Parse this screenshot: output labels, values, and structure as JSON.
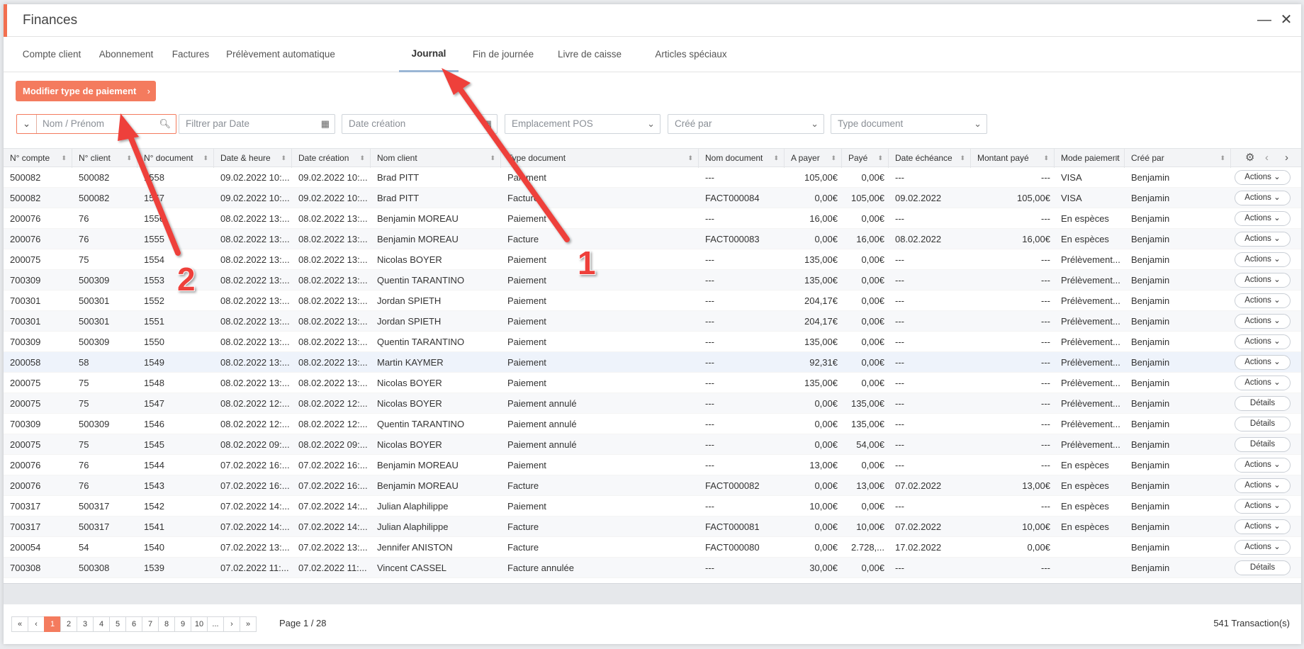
{
  "window": {
    "title": "Finances",
    "minimize_symbol": "—",
    "close_symbol": "✕"
  },
  "tabs": [
    {
      "label": "Compte client",
      "active": false
    },
    {
      "label": "Abonnement",
      "active": false
    },
    {
      "label": "Factures",
      "active": false
    },
    {
      "label": "Prélèvement automatique",
      "active": false
    },
    {
      "label": "Journal",
      "active": true
    },
    {
      "label": "Fin de journée",
      "active": false
    },
    {
      "label": "Livre de caisse",
      "active": false
    },
    {
      "label": "Articles spéciaux",
      "active": false
    }
  ],
  "toolbar": {
    "modify_payment_label": "Modifier type de paiement"
  },
  "filters": {
    "search_placeholder": "Nom / Prénom",
    "date_placeholder": "Filtrer par Date",
    "creation_date_placeholder": "Date création",
    "pos_placeholder": "Emplacement POS",
    "created_by_placeholder": "Créé par",
    "doc_type_placeholder": "Type document"
  },
  "columns": [
    "N° compte",
    "N° client",
    "N° document",
    "Date & heure",
    "Date création",
    "Nom client",
    "Type document",
    "Nom document",
    "A payer",
    "Payé",
    "Date échéance",
    "Montant payé",
    "Mode paiement",
    "Créé par"
  ],
  "rows": [
    {
      "cells": [
        "500082",
        "500082",
        "1558",
        "09.02.2022 10:...",
        "09.02.2022 10:...",
        "Brad PITT",
        "Paiement",
        "---",
        "105,00€",
        "0,00€",
        "---",
        "---",
        "VISA",
        "Benjamin"
      ],
      "action": "Actions ⌄"
    },
    {
      "cells": [
        "500082",
        "500082",
        "1557",
        "09.02.2022 10:...",
        "09.02.2022 10:...",
        "Brad PITT",
        "Facture",
        "FACT000084",
        "0,00€",
        "105,00€",
        "09.02.2022",
        "105,00€",
        "VISA",
        "Benjamin"
      ],
      "action": "Actions ⌄"
    },
    {
      "cells": [
        "200076",
        "76",
        "1556",
        "08.02.2022 13:...",
        "08.02.2022 13:...",
        "Benjamin MOREAU",
        "Paiement",
        "---",
        "16,00€",
        "0,00€",
        "---",
        "---",
        "En espèces",
        "Benjamin"
      ],
      "action": "Actions ⌄"
    },
    {
      "cells": [
        "200076",
        "76",
        "1555",
        "08.02.2022 13:...",
        "08.02.2022 13:...",
        "Benjamin MOREAU",
        "Facture",
        "FACT000083",
        "0,00€",
        "16,00€",
        "08.02.2022",
        "16,00€",
        "En espèces",
        "Benjamin"
      ],
      "action": "Actions ⌄"
    },
    {
      "cells": [
        "200075",
        "75",
        "1554",
        "08.02.2022 13:...",
        "08.02.2022 13:...",
        "Nicolas BOYER",
        "Paiement",
        "---",
        "135,00€",
        "0,00€",
        "---",
        "---",
        "Prélèvement...",
        "Benjamin"
      ],
      "action": "Actions ⌄"
    },
    {
      "cells": [
        "700309",
        "500309",
        "1553",
        "08.02.2022 13:...",
        "08.02.2022 13:...",
        "Quentin TARANTINO",
        "Paiement",
        "---",
        "135,00€",
        "0,00€",
        "---",
        "---",
        "Prélèvement...",
        "Benjamin"
      ],
      "action": "Actions ⌄"
    },
    {
      "cells": [
        "700301",
        "500301",
        "1552",
        "08.02.2022 13:...",
        "08.02.2022 13:...",
        "Jordan SPIETH",
        "Paiement",
        "---",
        "204,17€",
        "0,00€",
        "---",
        "---",
        "Prélèvement...",
        "Benjamin"
      ],
      "action": "Actions ⌄"
    },
    {
      "cells": [
        "700301",
        "500301",
        "1551",
        "08.02.2022 13:...",
        "08.02.2022 13:...",
        "Jordan SPIETH",
        "Paiement",
        "---",
        "204,17€",
        "0,00€",
        "---",
        "---",
        "Prélèvement...",
        "Benjamin"
      ],
      "action": "Actions ⌄"
    },
    {
      "cells": [
        "700309",
        "500309",
        "1550",
        "08.02.2022 13:...",
        "08.02.2022 13:...",
        "Quentin TARANTINO",
        "Paiement",
        "---",
        "135,00€",
        "0,00€",
        "---",
        "---",
        "Prélèvement...",
        "Benjamin"
      ],
      "action": "Actions ⌄"
    },
    {
      "cells": [
        "200058",
        "58",
        "1549",
        "08.02.2022 13:...",
        "08.02.2022 13:...",
        "Martin KAYMER",
        "Paiement",
        "---",
        "92,31€",
        "0,00€",
        "---",
        "---",
        "Prélèvement...",
        "Benjamin"
      ],
      "action": "Actions ⌄"
    },
    {
      "cells": [
        "200075",
        "75",
        "1548",
        "08.02.2022 13:...",
        "08.02.2022 13:...",
        "Nicolas BOYER",
        "Paiement",
        "---",
        "135,00€",
        "0,00€",
        "---",
        "---",
        "Prélèvement...",
        "Benjamin"
      ],
      "action": "Actions ⌄"
    },
    {
      "cells": [
        "200075",
        "75",
        "1547",
        "08.02.2022 12:...",
        "08.02.2022 12:...",
        "Nicolas BOYER",
        "Paiement annulé",
        "---",
        "0,00€",
        "135,00€",
        "---",
        "---",
        "Prélèvement...",
        "Benjamin"
      ],
      "action": "Détails"
    },
    {
      "cells": [
        "700309",
        "500309",
        "1546",
        "08.02.2022 12:...",
        "08.02.2022 12:...",
        "Quentin TARANTINO",
        "Paiement annulé",
        "---",
        "0,00€",
        "135,00€",
        "---",
        "---",
        "Prélèvement...",
        "Benjamin"
      ],
      "action": "Détails"
    },
    {
      "cells": [
        "200075",
        "75",
        "1545",
        "08.02.2022 09:...",
        "08.02.2022 09:...",
        "Nicolas BOYER",
        "Paiement annulé",
        "---",
        "0,00€",
        "54,00€",
        "---",
        "---",
        "Prélèvement...",
        "Benjamin"
      ],
      "action": "Détails"
    },
    {
      "cells": [
        "200076",
        "76",
        "1544",
        "07.02.2022 16:...",
        "07.02.2022 16:...",
        "Benjamin MOREAU",
        "Paiement",
        "---",
        "13,00€",
        "0,00€",
        "---",
        "---",
        "En espèces",
        "Benjamin"
      ],
      "action": "Actions ⌄"
    },
    {
      "cells": [
        "200076",
        "76",
        "1543",
        "07.02.2022 16:...",
        "07.02.2022 16:...",
        "Benjamin MOREAU",
        "Facture",
        "FACT000082",
        "0,00€",
        "13,00€",
        "07.02.2022",
        "13,00€",
        "En espèces",
        "Benjamin"
      ],
      "action": "Actions ⌄"
    },
    {
      "cells": [
        "700317",
        "500317",
        "1542",
        "07.02.2022 14:...",
        "07.02.2022 14:...",
        "Julian Alaphilippe",
        "Paiement",
        "---",
        "10,00€",
        "0,00€",
        "---",
        "---",
        "En espèces",
        "Benjamin"
      ],
      "action": "Actions ⌄"
    },
    {
      "cells": [
        "700317",
        "500317",
        "1541",
        "07.02.2022 14:...",
        "07.02.2022 14:...",
        "Julian Alaphilippe",
        "Facture",
        "FACT000081",
        "0,00€",
        "10,00€",
        "07.02.2022",
        "10,00€",
        "En espèces",
        "Benjamin"
      ],
      "action": "Actions ⌄"
    },
    {
      "cells": [
        "200054",
        "54",
        "1540",
        "07.02.2022 13:...",
        "07.02.2022 13:...",
        "Jennifer ANISTON",
        "Facture",
        "FACT000080",
        "0,00€",
        "2.728,...",
        "17.02.2022",
        "0,00€",
        "",
        "Benjamin"
      ],
      "action": "Actions ⌄"
    },
    {
      "cells": [
        "700308",
        "500308",
        "1539",
        "07.02.2022 11:...",
        "07.02.2022 11:...",
        "Vincent CASSEL",
        "Facture annulée",
        "---",
        "30,00€",
        "0,00€",
        "---",
        "---",
        "",
        "Benjamin"
      ],
      "action": "Détails"
    }
  ],
  "pagination": {
    "first": "«",
    "prev": "‹",
    "pages": [
      "1",
      "2",
      "3",
      "4",
      "5",
      "6",
      "7",
      "8",
      "9",
      "10",
      "..."
    ],
    "next": "›",
    "last": "»",
    "current": "1",
    "page_info": "Page 1 / 28",
    "total": "541 Transaction(s)"
  },
  "annotations": [
    "1",
    "2"
  ],
  "colors": {
    "accent": "#f47b5e",
    "arrow": "#ee3f3b",
    "tab_underline": "#9ab6d5"
  }
}
